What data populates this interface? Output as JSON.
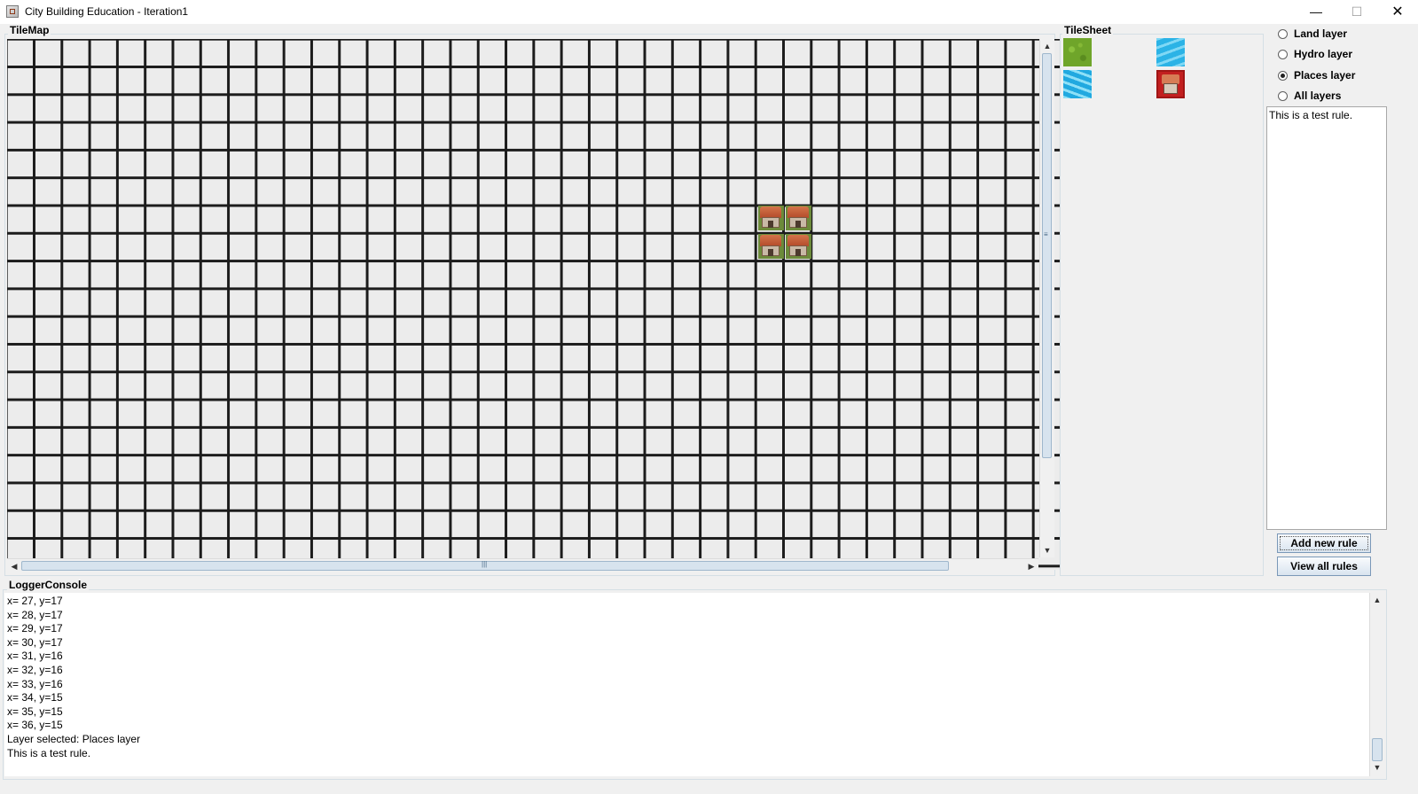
{
  "window": {
    "title": "City Building Education - Iteration1",
    "minimize": "—",
    "maximize": "☐",
    "close": "✕"
  },
  "tilemap": {
    "label": "TileMap",
    "placed_tiles": [
      {
        "name": "place-tile-1"
      },
      {
        "name": "place-tile-2"
      },
      {
        "name": "place-tile-3"
      },
      {
        "name": "place-tile-4"
      }
    ],
    "scroll_up": "▲",
    "scroll_down": "▼",
    "scroll_left": "◀",
    "scroll_right": "▶"
  },
  "tilesheet": {
    "label": "TileSheet",
    "tiles": [
      "grass-tile",
      "water-tile",
      "water-tile",
      "house-tile"
    ]
  },
  "layers": {
    "options": [
      {
        "label": "Land layer",
        "checked": false
      },
      {
        "label": "Hydro layer",
        "checked": false
      },
      {
        "label": "Places layer",
        "checked": true
      },
      {
        "label": "All layers",
        "checked": false
      }
    ]
  },
  "rules": {
    "text": "This is a test rule.",
    "add_button": "Add new rule",
    "view_button": "View all rules"
  },
  "console": {
    "label": "LoggerConsole",
    "lines": [
      "x= 27, y=17",
      "x= 28, y=17",
      "x= 29, y=17",
      "x= 30, y=17",
      "x= 31, y=16",
      "x= 32, y=16",
      "x= 33, y=16",
      "x= 34, y=15",
      "x= 35, y=15",
      "x= 36, y=15",
      "Layer selected: Places layer",
      "This is a test rule."
    ]
  }
}
